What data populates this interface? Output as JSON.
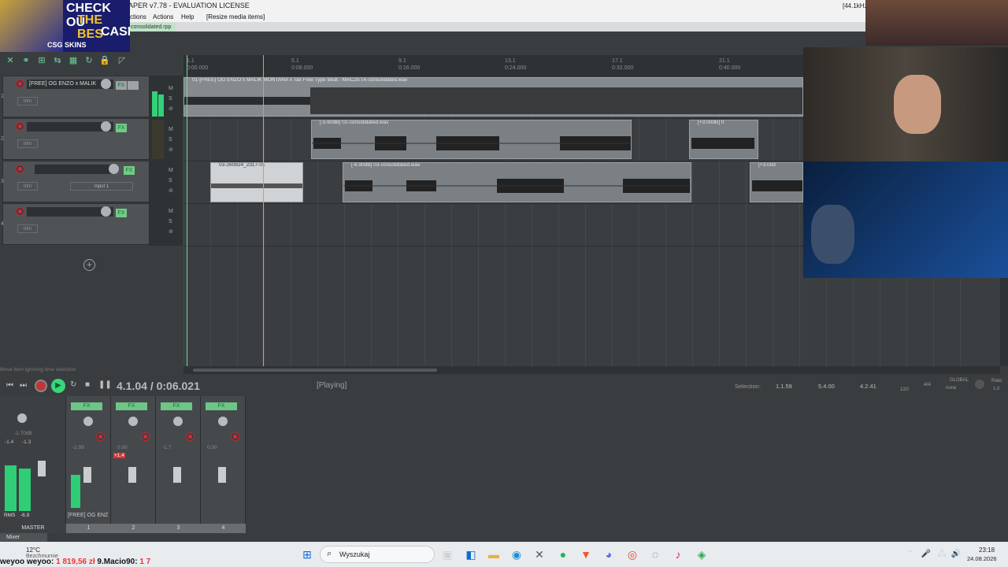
{
  "window": {
    "title": "APER v7.78 - EVALUATION LICENSE",
    "sample_rate": "[44.1kHz"
  },
  "menu": {
    "items": [
      "ctions",
      "Actions",
      "Help",
      "[Resize media items]"
    ]
  },
  "project_tab": "consolidated.rpp",
  "ruler": {
    "marks": [
      {
        "bar": "1.1",
        "time": "0:00.000"
      },
      {
        "bar": "5.1",
        "time": "0:08.000"
      },
      {
        "bar": "9.1",
        "time": "0:16.000"
      },
      {
        "bar": "13.1",
        "time": "0:24.000"
      },
      {
        "bar": "17.1",
        "time": "0:32.000"
      },
      {
        "bar": "21.1",
        "time": "0:40.000"
      }
    ]
  },
  "tracks": [
    {
      "num": "1",
      "name": "[FREE] OG ENZO x MALIK",
      "trim": "trim"
    },
    {
      "num": "2",
      "name": "",
      "trim": "trim"
    },
    {
      "num": "3",
      "name": "",
      "trim": "trim",
      "input": "Input 1"
    },
    {
      "num": "4",
      "name": "",
      "trim": "trim"
    }
  ],
  "clips": [
    {
      "name": "01-[FREE] OG ENZO x MALIK MONTANA x Tax Free Type Beat - MACZETA-consolidated.wav"
    },
    {
      "name": "[-5.60dB] 02-consolidated.wav"
    },
    {
      "name": "[+3.00dB] 0"
    },
    {
      "name": "03-260824_2317-01"
    },
    {
      "name": "[-6.90dB] 03-consolidated.wav"
    },
    {
      "name": "[+3.00d"
    }
  ],
  "transport": {
    "position": "4.1.04 / 0:06.021",
    "status": "[Playing]",
    "selection_label": "Selection:",
    "selection_start": "1.1.59",
    "selection_end": "5.4.00",
    "selection_len": "4.2.41",
    "tempo": "120",
    "timesig": "4/4",
    "global": "GLOBAL",
    "none": "none",
    "rate_label": "Rate:",
    "rate": "1.0"
  },
  "statusbar": {
    "hint": "Move item ignoring time selection"
  },
  "mixer": {
    "master_label": "MASTER",
    "master_db": "-1.70dB",
    "master_peaks": [
      "-1.4",
      "-1.3"
    ],
    "rms": "RMS",
    "rms_val": "-6.9",
    "strips": [
      {
        "num": "1",
        "name": "[FREE] OG ENZ",
        "db": "-2.99",
        "fx": "FX"
      },
      {
        "num": "2",
        "name": "",
        "db": "0.00",
        "fx": "FX",
        "peak": "+1.4"
      },
      {
        "num": "3",
        "name": "",
        "db": "-1.7",
        "fx": "FX"
      },
      {
        "num": "4",
        "name": "",
        "db": "0.00",
        "fx": "FX"
      }
    ],
    "title": "Mixer"
  },
  "overlay": {
    "promo_line1": "CHECK OU",
    "promo_line2": "THE BES",
    "promo_line3": "CASE",
    "promo_brand": "CSG SKINS"
  },
  "taskbar": {
    "weather_temp": "12°C",
    "weather_desc": "Bezchmurnie",
    "search": "Wyszukaj",
    "time": "23:18",
    "date": "24.08.2026"
  },
  "chat": {
    "user1": "weyoo",
    "user1b": "weyoo:",
    "amount1": "1 819,56 zł",
    "user2": "9.Macio90:",
    "amount2": "1 7"
  },
  "colors": {
    "accent": "#6ad197",
    "clip": "#7b8084",
    "cursor": "#c9a64a"
  }
}
